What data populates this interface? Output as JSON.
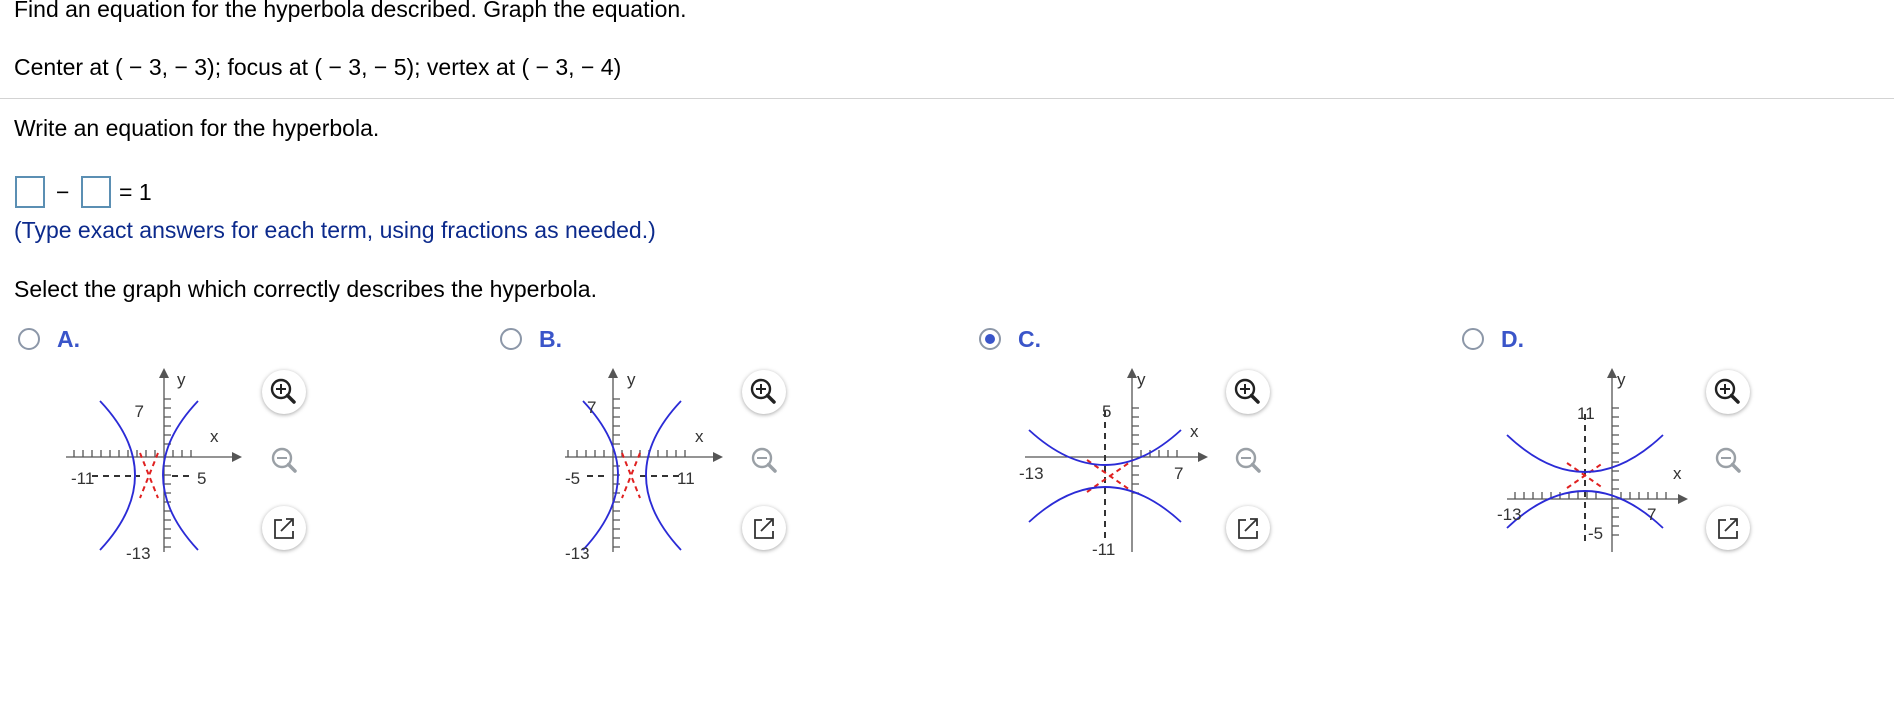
{
  "problem": {
    "instruction": "Find an equation for the hyperbola described.  Graph the equation.",
    "given": "Center at ( − 3, − 3);   focus at ( − 3, − 5);   vertex at ( − 3, − 4)"
  },
  "equation_part": {
    "prompt": "Write an equation for the hyperbola.",
    "minus": "−",
    "equals": "= 1",
    "first_term_value": "",
    "second_term_value": "",
    "hint": "(Type exact answers for each term, using fractions as needed.)"
  },
  "graph_part": {
    "prompt": "Select the graph which correctly describes the hyperbola.",
    "selected": "C",
    "options": [
      {
        "label": "A.",
        "selected": false,
        "x_ticks": [
          "-11",
          "5"
        ],
        "y_ticks": [
          "7",
          "-13"
        ],
        "x_axis": "x",
        "y_axis": "y"
      },
      {
        "label": "B.",
        "selected": false,
        "x_ticks": [
          "-5",
          "11"
        ],
        "y_ticks": [
          "7",
          "-13"
        ],
        "x_axis": "x",
        "y_axis": "y"
      },
      {
        "label": "C.",
        "selected": true,
        "x_ticks": [
          "-13",
          "7"
        ],
        "y_ticks": [
          "5",
          "-11"
        ],
        "x_axis": "x",
        "y_axis": "y"
      },
      {
        "label": "D.",
        "selected": false,
        "x_ticks": [
          "-13",
          "7"
        ],
        "y_ticks": [
          "11",
          "-5"
        ],
        "x_axis": "x",
        "y_axis": "y"
      }
    ],
    "tools": [
      "zoom-in-icon",
      "zoom-out-icon",
      "popout-icon"
    ]
  },
  "colors": {
    "hint_text": "#0c2a8c",
    "option_label": "#3a55c9",
    "curve": "#2b2bd6",
    "asymptote": "#e02020",
    "input_border": "#5b8fb3"
  }
}
